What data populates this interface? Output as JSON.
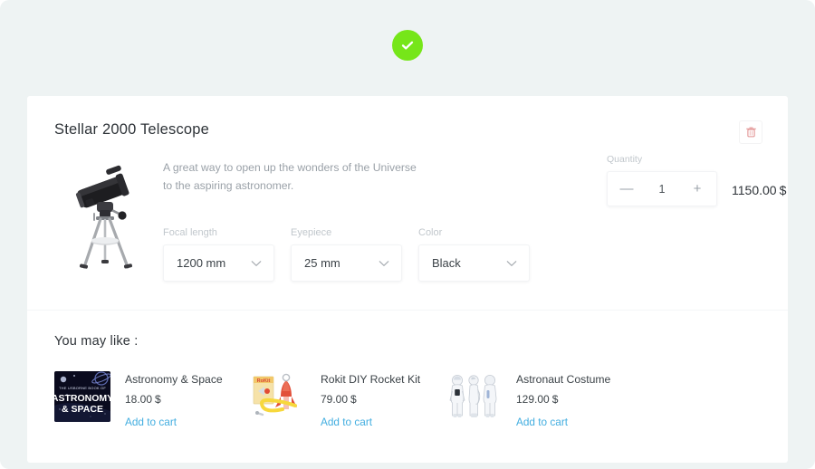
{
  "status": {
    "icon": "check-circle-icon",
    "color": "#76e619"
  },
  "product": {
    "title": "Stellar 2000 Telescope",
    "description": "A great way to open up the wonders of the Universe to the aspiring astronomer.",
    "image_alt": "telescope-image",
    "delete_icon": "trash-icon",
    "delete_color": "#e08f8f",
    "options": [
      {
        "label": "Focal length",
        "value": "1200 mm",
        "icon": "chevron-down-icon"
      },
      {
        "label": "Eyepiece",
        "value": "25 mm",
        "icon": "chevron-down-icon"
      },
      {
        "label": "Color",
        "value": "Black",
        "icon": "chevron-down-icon"
      }
    ],
    "quantity": {
      "label": "Quantity",
      "value": "1",
      "decrement_label": "—",
      "increment_label": "+"
    },
    "price": {
      "amount": "1150.00",
      "currency": "$"
    }
  },
  "recommendations": {
    "title": "You may like :",
    "items": [
      {
        "name": "Astronomy & Space",
        "price": "18.00",
        "currency": "$",
        "cta": "Add to cart",
        "image_alt": "astronomy-and-space-book-cover"
      },
      {
        "name": "Rokit DIY Rocket Kit",
        "price": "79.00",
        "currency": "$",
        "cta": "Add to cart",
        "image_alt": "rokit-diy-rocket-kit-image"
      },
      {
        "name": "Astronaut Costume",
        "price": "129.00",
        "currency": "$",
        "cta": "Add to cart",
        "image_alt": "astronaut-costume-image"
      }
    ]
  },
  "theme": {
    "page_background": "#eef3f3",
    "card_background": "#ffffff",
    "link_color": "#43aee0",
    "text_color": "#2e3338",
    "muted_color": "#9aa1a8"
  }
}
